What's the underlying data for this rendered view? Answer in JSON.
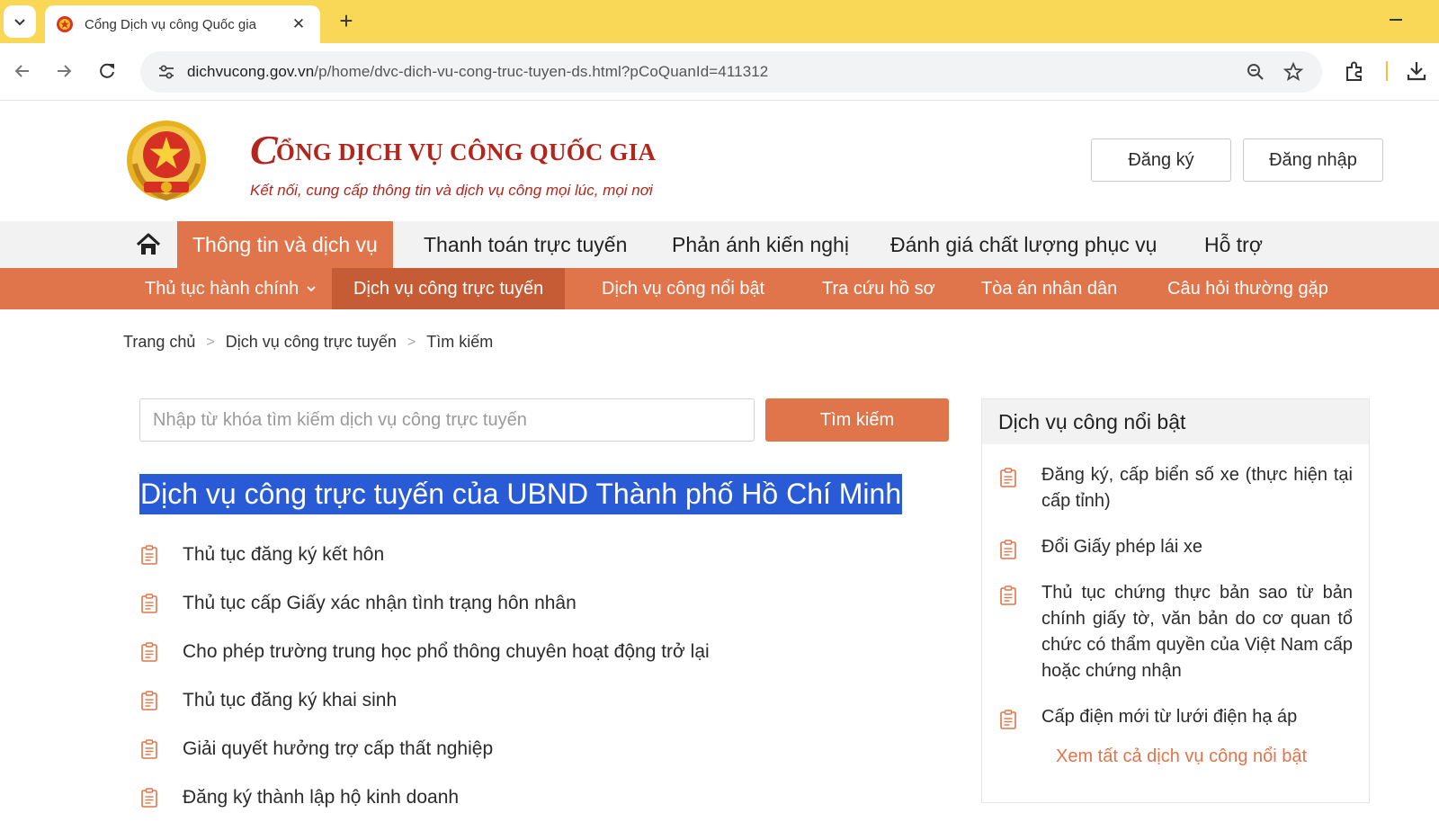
{
  "browser": {
    "tab_title": "Cổng Dịch vụ công Quốc gia",
    "url_host": "dichvucong.gov.vn",
    "url_path": "/p/home/dvc-dich-vu-cong-truc-tuyen-ds.html?pCoQuanId=411312"
  },
  "header": {
    "title_first_letter": "C",
    "title_rest": "ỔNG DỊCH VỤ CÔNG QUỐC GIA",
    "slogan": "Kết nối, cung cấp thông tin và dịch vụ công mọi lúc, mọi nơi",
    "register_label": "Đăng ký",
    "login_label": "Đăng nhập"
  },
  "main_nav": [
    {
      "label": "Thông tin và dịch vụ",
      "active": true
    },
    {
      "label": "Thanh toán trực tuyến"
    },
    {
      "label": "Phản ánh kiến nghị"
    },
    {
      "label": "Đánh giá chất lượng phục vụ"
    },
    {
      "label": "Hỗ trợ"
    }
  ],
  "sub_nav": [
    {
      "label": "Thủ tục hành chính"
    },
    {
      "label": "Dịch vụ công trực tuyến",
      "active": true
    },
    {
      "label": "Dịch vụ công nổi bật"
    },
    {
      "label": "Tra cứu hồ sơ"
    },
    {
      "label": "Tòa án nhân dân"
    },
    {
      "label": "Câu hỏi thường gặp"
    }
  ],
  "breadcrumb": [
    "Trang chủ",
    "Dịch vụ công trực tuyến",
    "Tìm kiếm"
  ],
  "search": {
    "placeholder": "Nhập từ khóa tìm kiếm dịch vụ công trực tuyến",
    "value": "",
    "button_label": "Tìm kiếm"
  },
  "section_title": "Dịch vụ công trực tuyến của UBND Thành phố Hồ Chí Minh",
  "services": [
    "Thủ tục đăng ký kết hôn",
    "Thủ tục cấp Giấy xác nhận tình trạng hôn nhân",
    "Cho phép trường trung học phổ thông chuyên hoạt động trở lại",
    "Thủ tục đăng ký khai sinh",
    "Giải quyết hưởng trợ cấp thất nghiệp",
    "Đăng ký thành lập hộ kinh doanh"
  ],
  "featured": {
    "heading": "Dịch vụ công nổi bật",
    "items": [
      "Đăng ký, cấp biển số xe (thực hiện tại cấp tỉnh)",
      "Đổi Giấy phép lái xe",
      "Thủ tục chứng thực bản sao từ bản chính giấy tờ, văn bản do cơ quan tổ chức có thẩm quyền của Việt Nam cấp hoặc chứng nhận",
      "Cấp điện mới từ lưới điện hạ áp"
    ],
    "more_link": "Xem tất cả dịch vụ công nổi bật"
  },
  "colors": {
    "accent": "#e0744a",
    "accent_dark": "#c65c35",
    "brand_red": "#b3261e",
    "chrome_yellow": "#f9d857",
    "selection_blue": "#2a5bd7"
  }
}
